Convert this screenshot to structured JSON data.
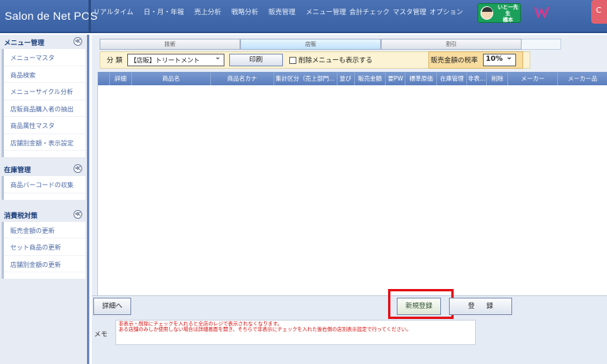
{
  "app": {
    "logo": "Salon de Net POS"
  },
  "nav": {
    "items": [
      "リアルタイム",
      "日・月・年報",
      "売上分析",
      "戦略分析",
      "販売管理",
      "メニュー管理",
      "会計チェック",
      "マスタ管理",
      "オプション"
    ],
    "user_line1": "いと一先生",
    "user_line2": "橋本",
    "corner_label": "C"
  },
  "sidebar": {
    "sections": [
      {
        "title": "メニュー管理",
        "toggle": "≪",
        "items": [
          "メニューマスタ",
          "商品検索",
          "メニューサイクル分析",
          "店販商品購入者の抽出",
          "商品属性マスタ",
          "店舗別金額・表示設定"
        ]
      },
      {
        "title": "在庫管理",
        "toggle": "≪",
        "items": [
          "商品バーコードの収集"
        ]
      },
      {
        "title": "消費税対策",
        "toggle": "≪",
        "items": [
          "販売金額の更新",
          "セット商品の更新",
          "店舗別金額の更新"
        ]
      }
    ]
  },
  "tabs": [
    "技術",
    "店販",
    "割引"
  ],
  "filter": {
    "category_label": "分 類",
    "category_value": "【店販】トリートメント",
    "print_label": "印刷",
    "show_deleted_label": "削除メニューも表示する",
    "tax_label": "販売金額の税率",
    "tax_value": "10%"
  },
  "table": {
    "columns": [
      "",
      "詳細",
      "商品名",
      "商品名カナ",
      "集計区分（売上部門…",
      "並び",
      "販売金額",
      "要PW",
      "標準原価",
      "在庫管理",
      "非表…",
      "削除",
      "メーカー",
      "メーカー品"
    ]
  },
  "footer": {
    "detail_button": "詳細へ",
    "new_button": "新規登録",
    "register_button": "登 録",
    "memo_label": "メモ",
    "memo_text": "非表示・削除にチェックを入れると全店のレジで表示されなくなります。\nある店舗のみしか使用しない場合は詳細画面を開き、そちらで非表示にチェックを入れた後右側の店別表示設定で行ってください。"
  }
}
